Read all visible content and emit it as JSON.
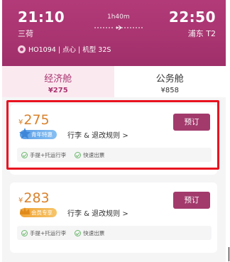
{
  "header": {
    "departure_time": "21:10",
    "departure_city": "三荷",
    "arrival_time": "22:50",
    "arrival_city": "浦东 T2",
    "duration": "1h40m",
    "flight_info": "HO1094 | 点心 | 机型 32S"
  },
  "tabs": [
    {
      "name": "经济舱",
      "price": "¥275"
    },
    {
      "name": "公务舱",
      "price": "¥858"
    }
  ],
  "fares": [
    {
      "currency": "¥",
      "price": "275",
      "badge": "青年特惠",
      "rules": "行李 & 退改规则 >",
      "book_label": "预订",
      "features": [
        "手提+托运行李",
        "快速出票"
      ]
    },
    {
      "currency": "¥",
      "price": "283",
      "badge": "会员专享",
      "rules": "行李 & 退改规则 >",
      "book_label": "预订",
      "features": [
        "手提+托运行李",
        "快速出票"
      ]
    }
  ],
  "colors": {
    "brand": "#a9346f",
    "price": "#d9812b",
    "highlight": "#e8121f"
  }
}
